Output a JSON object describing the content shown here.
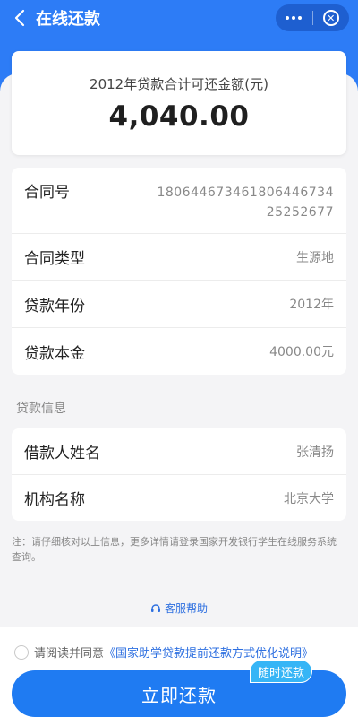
{
  "nav": {
    "title": "在线还款"
  },
  "summary": {
    "label": "2012年贷款合计可还金额(元)",
    "amount": "4,040.00"
  },
  "loan_details": [
    {
      "key": "合同号",
      "value": "18064467346180644673425252677"
    },
    {
      "key": "合同类型",
      "value": "生源地"
    },
    {
      "key": "贷款年份",
      "value": "2012年"
    },
    {
      "key": "贷款本金",
      "value": "4000.00元"
    }
  ],
  "borrower_section": {
    "title": "贷款信息",
    "rows": [
      {
        "key": "借款人姓名",
        "value": "张清扬"
      },
      {
        "key": "机构名称",
        "value": "北京大学"
      }
    ]
  },
  "note": "注：请仔细核对以上信息，更多详情请登录国家开发银行学生在线服务系统查询。",
  "help_label": "客服帮助",
  "agreement": {
    "prefix": "请阅读并同意",
    "link": "《国家助学贷款提前还款方式优化说明》"
  },
  "pay_button": "立即还款",
  "badge": "随时还款",
  "colors": {
    "primary": "#1f7bf2",
    "header": "#2d7cf6",
    "badge": "#36b5f6",
    "link": "#2d6fe0"
  },
  "icons": [
    "back-arrow-icon",
    "more-dots-icon",
    "close-circle-icon",
    "headset-icon"
  ]
}
